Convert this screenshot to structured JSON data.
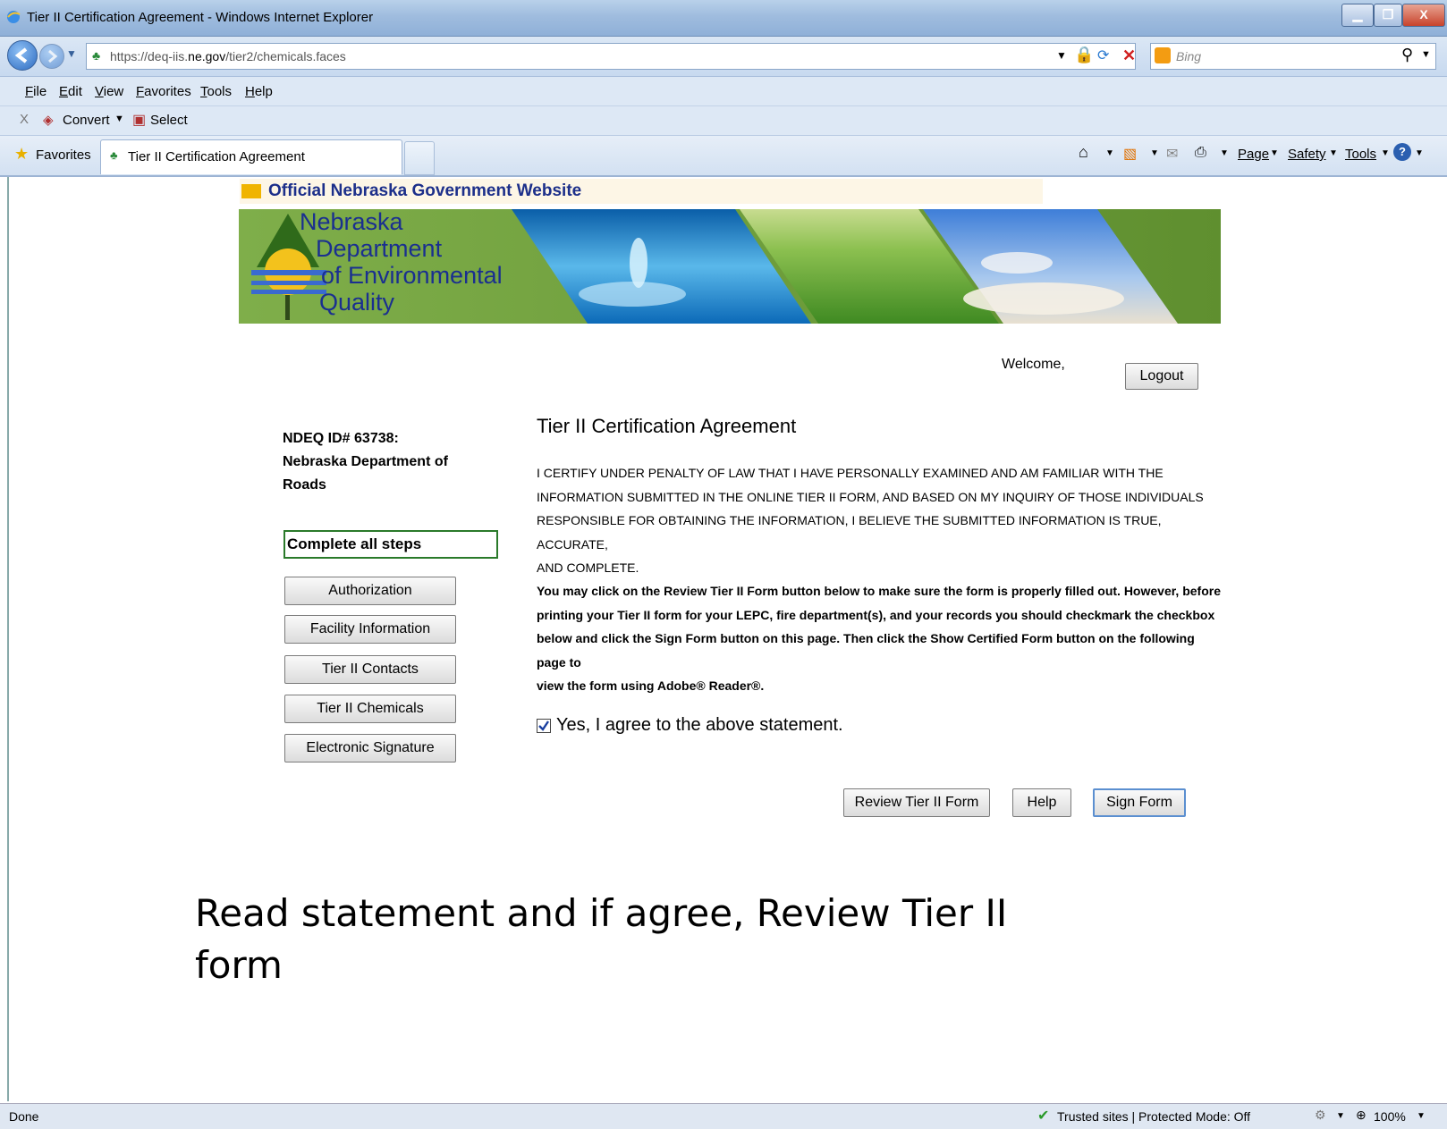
{
  "window": {
    "title": "Tier II Certification Agreement - Windows Internet Explorer"
  },
  "address_bar": {
    "url_prefix": "https://deq-iis.",
    "url_domain": "ne.gov",
    "url_suffix": "/tier2/chemicals.faces",
    "search_placeholder": "Bing"
  },
  "menu": {
    "items": [
      "File",
      "Edit",
      "View",
      "Favorites",
      "Tools",
      "Help"
    ]
  },
  "toolbar": {
    "convert_label": "Convert",
    "select_label": "Select"
  },
  "favorites_bar": {
    "favorites_label": "Favorites",
    "tab_label": "Tier II Certification Agreement",
    "page_label": "Page",
    "safety_label": "Safety",
    "tools_label": "Tools"
  },
  "site": {
    "official_banner": "Official Nebraska Government Website",
    "logo_lines": [
      "Nebraska",
      "Department",
      "of Environmental",
      "Quality"
    ],
    "welcome_text": "Welcome,",
    "logout_label": "Logout"
  },
  "sidebar": {
    "facility_id": "NDEQ ID# 63738:",
    "facility_name_line1": "Nebraska Department of",
    "facility_name_line2": "Roads",
    "steps_heading": "Complete all steps",
    "steps": [
      "Authorization",
      "Facility Information",
      "Tier II Contacts",
      "Tier II Chemicals",
      "Electronic Signature"
    ]
  },
  "main": {
    "heading": "Tier II Certification Agreement",
    "certify_lines": [
      "I CERTIFY UNDER PENALTY OF LAW THAT I HAVE PERSONALLY EXAMINED AND AM FAMILIAR WITH THE",
      "INFORMATION SUBMITTED IN THE ONLINE TIER II FORM, AND BASED ON MY INQUIRY OF THOSE INDIVIDUALS",
      "RESPONSIBLE FOR OBTAINING THE INFORMATION, I BELIEVE THE SUBMITTED INFORMATION IS TRUE, ACCURATE,",
      "AND COMPLETE."
    ],
    "instruction_lines": [
      "You may click on the Review Tier II Form button below to make sure the form is properly filled out. However, before",
      "printing your Tier II form for your LEPC, fire department(s), and your records you should checkmark the checkbox",
      "below and click the Sign Form button on this page. Then click the Show Certified Form button on the following page to",
      "view the form using Adobe® Reader®."
    ],
    "agree_label": "Yes, I agree to the above statement.",
    "agree_checked": true,
    "buttons": {
      "review": "Review Tier II Form",
      "help": "Help",
      "sign": "Sign Form"
    }
  },
  "caption": {
    "line1": "Read statement and if agree, Review Tier II",
    "line2": "form"
  },
  "status_bar": {
    "done": "Done",
    "zone": "Trusted sites | Protected Mode: Off",
    "zoom": "100%"
  }
}
